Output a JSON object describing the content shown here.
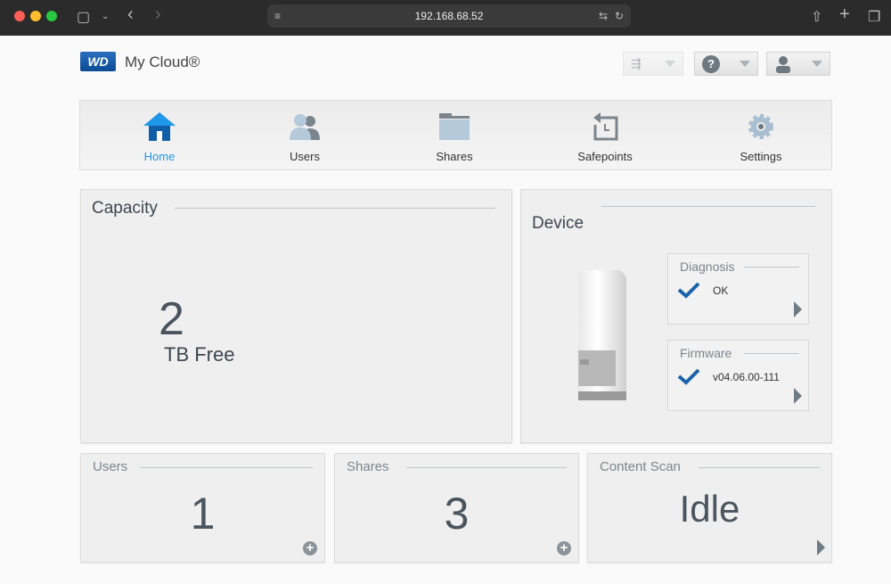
{
  "browser": {
    "url": "192.168.68.52"
  },
  "header": {
    "logo_text": "WD",
    "brand": "My Cloud®"
  },
  "nav": [
    {
      "label": "Home",
      "icon": "home-icon",
      "active": true
    },
    {
      "label": "Users",
      "icon": "users-icon"
    },
    {
      "label": "Shares",
      "icon": "folder-icon"
    },
    {
      "label": "Safepoints",
      "icon": "safepoint-icon"
    },
    {
      "label": "Settings",
      "icon": "gear-icon"
    }
  ],
  "capacity": {
    "title": "Capacity",
    "value": "2",
    "unit": "TB Free"
  },
  "device": {
    "title": "Device",
    "diagnosis": {
      "title": "Diagnosis",
      "status": "OK"
    },
    "firmware": {
      "title": "Firmware",
      "version": "v04.06.00-111"
    }
  },
  "users": {
    "title": "Users",
    "count": "1"
  },
  "shares": {
    "title": "Shares",
    "count": "3"
  },
  "content_scan": {
    "title": "Content Scan",
    "status": "Idle"
  },
  "colors": {
    "accent": "#1e97e8",
    "check": "#1a63a8"
  }
}
